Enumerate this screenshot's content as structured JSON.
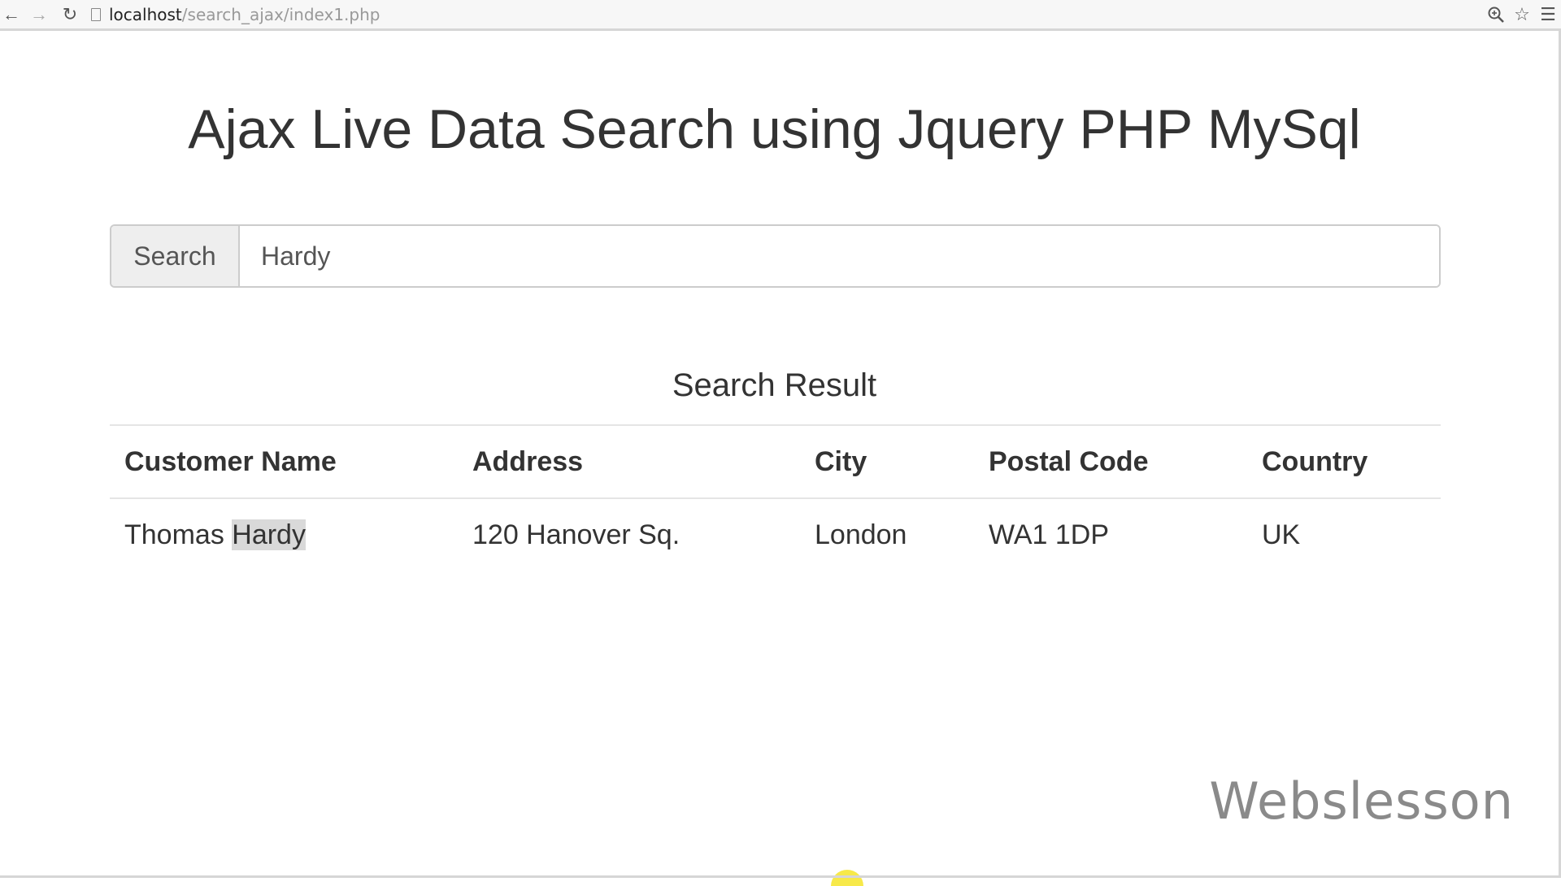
{
  "browser": {
    "url_host": "localhost",
    "url_path": "/search_ajax/index1.php",
    "back_icon": "arrow-left-icon",
    "forward_icon": "arrow-right-icon",
    "reload_icon": "reload-icon",
    "zoom_icon": "zoom-icon",
    "bookmark_icon": "star-icon",
    "menu_icon": "menu-icon"
  },
  "page": {
    "title": "Ajax Live Data Search using Jquery PHP MySql"
  },
  "search": {
    "addon_label": "Search",
    "value": "Hardy"
  },
  "results": {
    "heading": "Search Result",
    "columns": [
      "Customer Name",
      "Address",
      "City",
      "Postal Code",
      "Country"
    ],
    "rows": [
      {
        "name_prefix": "Thomas ",
        "name_match": "Hardy",
        "address": "120 Hanover Sq.",
        "city": "London",
        "postal_code": "WA1 1DP",
        "country": "UK"
      }
    ]
  },
  "watermark": "Webslesson",
  "colors": {
    "highlight": "#d9d9d9",
    "addon_bg": "#eeeeee",
    "text": "#333333"
  }
}
